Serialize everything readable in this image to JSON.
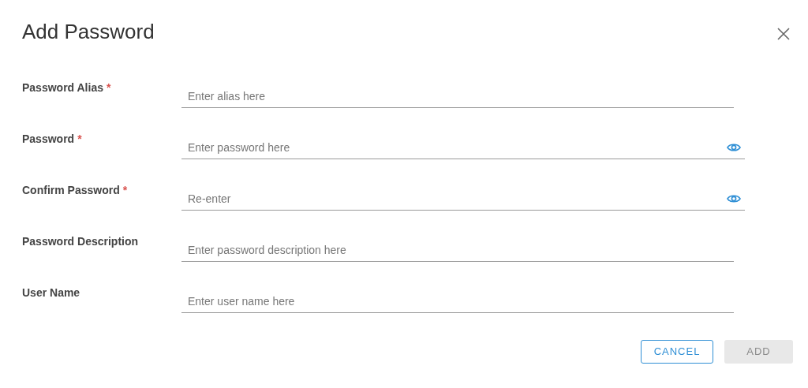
{
  "dialog": {
    "title": "Add Password",
    "fields": [
      {
        "label": "Password Alias",
        "required_mark": "*",
        "placeholder": "Enter alias here",
        "kind": "text"
      },
      {
        "label": "Password",
        "required_mark": "*",
        "placeholder": "Enter password here",
        "kind": "password"
      },
      {
        "label": "Confirm Password",
        "required_mark": "*",
        "placeholder": "Re-enter",
        "kind": "password"
      },
      {
        "label": "Password Description",
        "placeholder": "Enter password description here",
        "kind": "text"
      },
      {
        "label": "User Name",
        "placeholder": "Enter user name here",
        "kind": "text"
      }
    ],
    "buttons": [
      {
        "label": "CANCEL",
        "disabled": false
      },
      {
        "label": "ADD",
        "disabled": true
      }
    ]
  }
}
